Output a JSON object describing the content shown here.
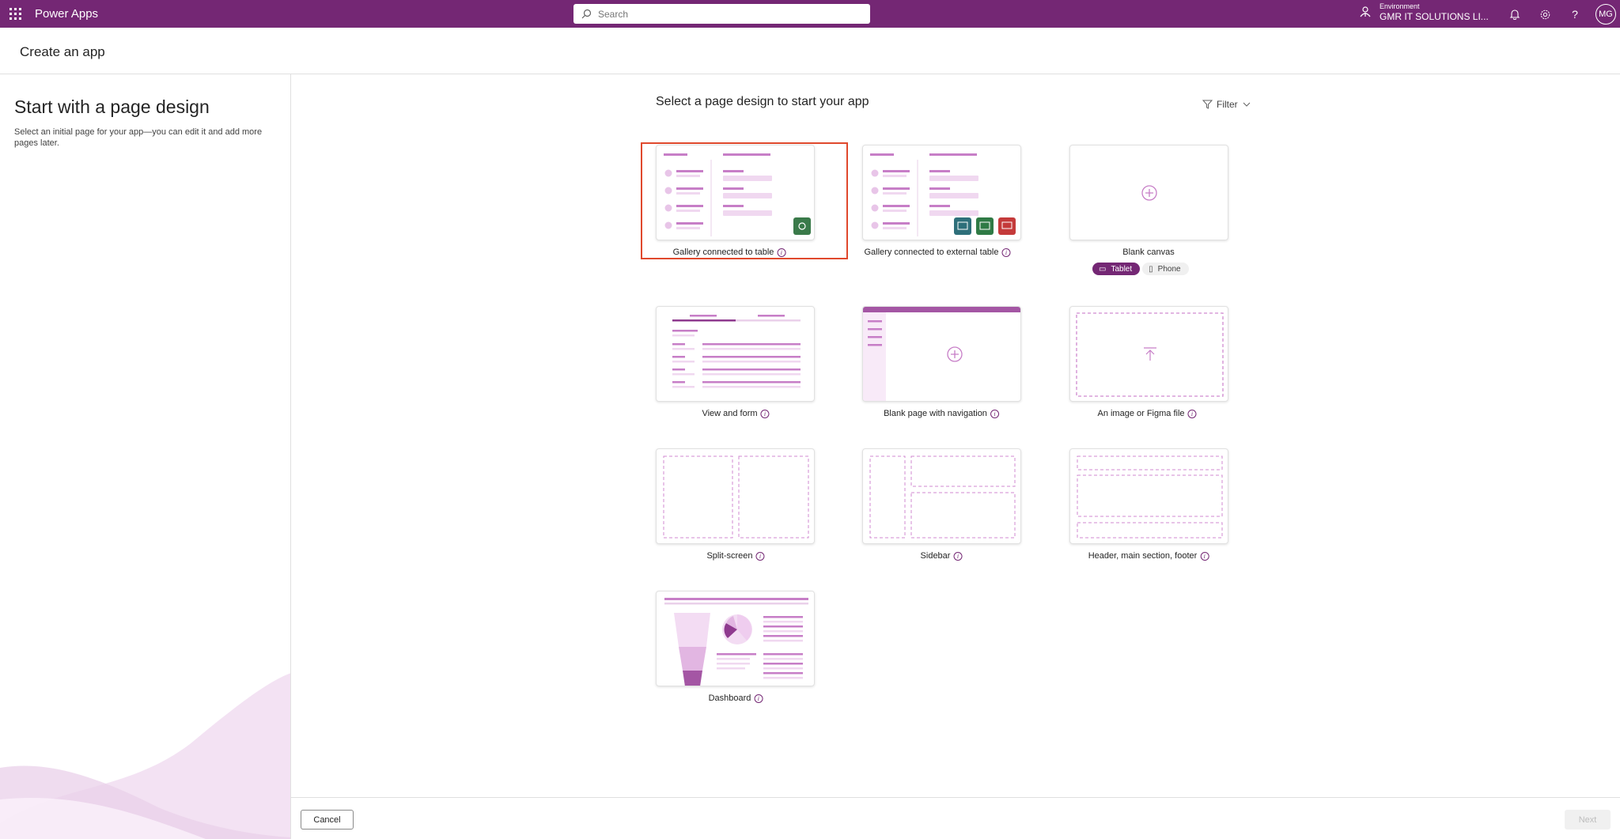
{
  "topbar": {
    "app_name": "Power Apps",
    "search_placeholder": "Search",
    "environment_label": "Environment",
    "environment_name": "GMR IT SOLUTIONS LI...",
    "avatar_initials": "MG",
    "color": "#742774"
  },
  "header": {
    "title": "Create an app"
  },
  "left": {
    "title": "Start with a page design",
    "description": "Select an initial page for your app—you can edit it and add more pages later."
  },
  "main": {
    "heading": "Select a page design to start your app",
    "filter_label": "Filter",
    "cards": [
      {
        "label": "Gallery connected to table",
        "info": true,
        "selected": true
      },
      {
        "label": "Gallery connected to external table",
        "info": true
      },
      {
        "label": "Blank canvas",
        "info": false
      },
      {
        "label": "View and form",
        "info": true
      },
      {
        "label": "Blank page with navigation",
        "info": true
      },
      {
        "label": "An image or Figma file",
        "info": true
      },
      {
        "label": "Split-screen",
        "info": true
      },
      {
        "label": "Sidebar",
        "info": true
      },
      {
        "label": "Header, main section, footer",
        "info": true
      },
      {
        "label": "Dashboard",
        "info": true
      }
    ],
    "layout_toggle": {
      "tablet": "Tablet",
      "phone": "Phone",
      "selected": "Tablet"
    }
  },
  "footer": {
    "cancel": "Cancel",
    "next": "Next"
  }
}
